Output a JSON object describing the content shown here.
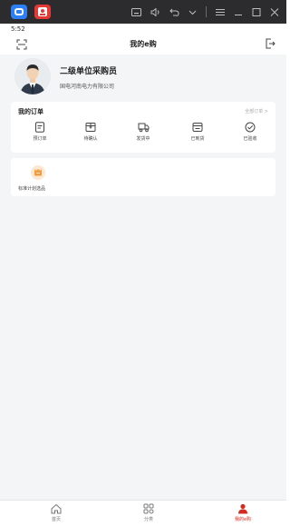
{
  "status_bar": {
    "time": "5:52"
  },
  "header": {
    "title": "我的e购"
  },
  "profile": {
    "name": "二级单位采购员",
    "company": "国电河南电力有限公司"
  },
  "orders": {
    "title": "我的订单",
    "view_all": "全部订单 >",
    "items": [
      {
        "label": "预订单",
        "icon": "order-doc-icon"
      },
      {
        "label": "待确认",
        "icon": "confirm-box-icon"
      },
      {
        "label": "发货中",
        "icon": "truck-icon"
      },
      {
        "label": "已到货",
        "icon": "delivered-icon"
      },
      {
        "label": "已验收",
        "icon": "check-circle-icon"
      }
    ]
  },
  "plan": {
    "label": "标准计划选品",
    "icon": "plan-select-icon",
    "icon_color": "#f39c3d"
  },
  "tabbar": {
    "items": [
      {
        "label": "首页",
        "icon": "home-icon"
      },
      {
        "label": "分类",
        "icon": "category-icon"
      },
      {
        "label": "我的e购",
        "icon": "profile-icon",
        "active": true
      }
    ],
    "active_color": "#d42a20"
  }
}
